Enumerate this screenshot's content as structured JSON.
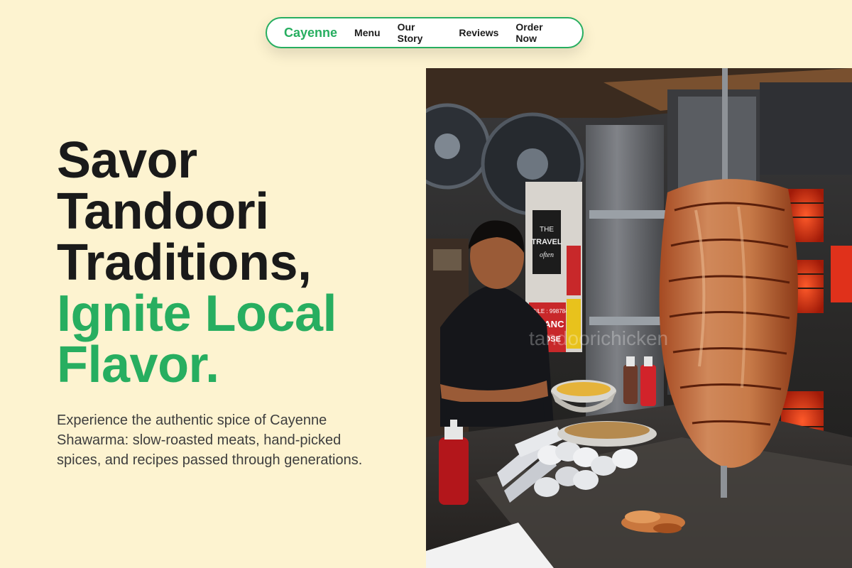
{
  "nav": {
    "brand": "Cayenne",
    "links": [
      "Menu",
      "Our Story",
      "Reviews",
      "Order Now"
    ]
  },
  "hero": {
    "headline_dark": [
      "Savor",
      "Tandoori",
      "Traditions,"
    ],
    "headline_green": [
      "Ignite Local",
      "Flavor."
    ],
    "subtext": "Experience the authentic spice of Cayenne Shawarma: slow-roasted meats, hand-picked spices, and recipes passed through generations.",
    "image": {
      "watermark": "tandoorichicken",
      "poster_lines": [
        "THE",
        "TRAVEL",
        "often"
      ],
      "sign_lines": [
        "MOBILE : 9987845",
        "BRANC",
        "CLOSE"
      ],
      "subject": "shawarma-spit"
    }
  },
  "colors": {
    "background": "#fdf3d0",
    "accent": "#27ae60",
    "text_dark": "#1a1a1a",
    "text_body": "#3e3e3e"
  }
}
